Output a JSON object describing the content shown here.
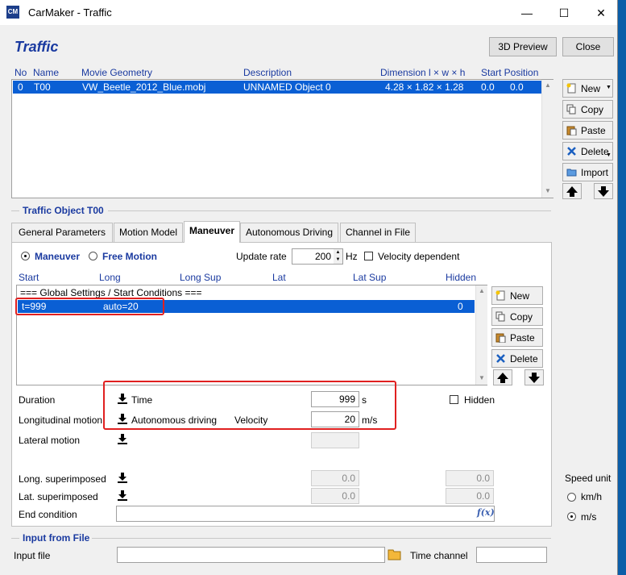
{
  "window": {
    "title": "CarMaker - Traffic",
    "app_icon": "CM"
  },
  "header": {
    "title": "Traffic",
    "preview_label": "3D Preview",
    "close_label": "Close"
  },
  "objects_table": {
    "columns": [
      "No",
      "Name",
      "Movie Geometry",
      "Description",
      "Dimension l × w × h",
      "Start Position"
    ],
    "rows": [
      {
        "no": "0",
        "name": "T00",
        "movie": "VW_Beetle_2012_Blue.mobj",
        "description": "UNNAMED Object 0",
        "dimension": "4.28 × 1.82 × 1.28",
        "pos1": "0.0",
        "pos2": "0.0"
      }
    ]
  },
  "side_buttons": {
    "new": "New",
    "copy": "Copy",
    "paste": "Paste",
    "delete": "Delete",
    "import": "Import"
  },
  "object_group": {
    "title": "Traffic Object T00",
    "tabs": [
      "General Parameters",
      "Motion Model",
      "Maneuver",
      "Autonomous Driving",
      "Channel in File"
    ],
    "active_tab": "Maneuver"
  },
  "maneuver": {
    "mode_maneuver": "Maneuver",
    "mode_free": "Free Motion",
    "update_rate_label": "Update rate",
    "update_rate_value": "200",
    "update_rate_unit": "Hz",
    "velocity_dependent": "Velocity dependent",
    "list_columns": [
      "Start",
      "Long",
      "Long Sup",
      "Lat",
      "Lat Sup",
      "Hidden"
    ],
    "list_rows": [
      {
        "text": "=== Global Settings / Start Conditions ==="
      },
      {
        "start": "t=999",
        "long": "auto=20",
        "hidden": "0"
      }
    ],
    "buttons": {
      "new": "New",
      "copy": "Copy",
      "paste": "Paste",
      "delete": "Delete"
    },
    "duration_label": "Duration",
    "duration_mode": "Time",
    "duration_value": "999",
    "duration_unit": "s",
    "hidden_label": "Hidden",
    "long_label": "Longitudinal motion",
    "long_mode": "Autonomous driving",
    "velocity_label": "Velocity",
    "velocity_value": "20",
    "velocity_unit": "m/s",
    "lat_label": "Lateral motion",
    "long_sup_label": "Long. superimposed",
    "long_sup_v1": "0.0",
    "long_sup_v2": "0.0",
    "lat_sup_label": "Lat. superimposed",
    "lat_sup_v1": "0.0",
    "lat_sup_v2": "0.0",
    "end_condition_label": "End condition",
    "fx_symbol": "f(x)"
  },
  "speed_unit": {
    "title": "Speed unit",
    "kmh": "km/h",
    "ms": "m/s",
    "selected": "m/s"
  },
  "input_file": {
    "title": "Input from File",
    "label": "Input file",
    "channel_label": "Time channel"
  },
  "colors": {
    "accent": "#1a3aa0",
    "selection": "#0a5fd4",
    "highlight": "#e02020"
  }
}
